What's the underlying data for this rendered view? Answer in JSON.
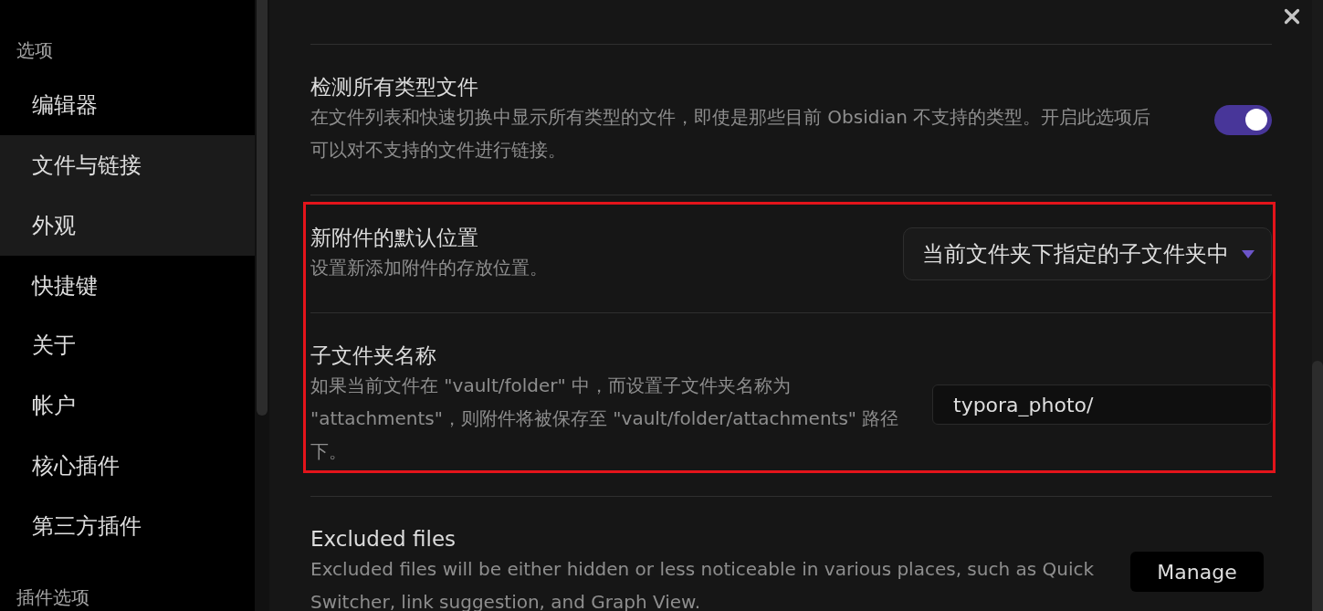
{
  "sidebar": {
    "header": "选项",
    "items": [
      {
        "label": "编辑器",
        "highlighted": false
      },
      {
        "label": "文件与链接",
        "highlighted": true
      },
      {
        "label": "外观",
        "highlighted": true
      },
      {
        "label": "快捷键",
        "highlighted": false
      },
      {
        "label": "关于",
        "highlighted": false
      },
      {
        "label": "帐户",
        "highlighted": false
      },
      {
        "label": "核心插件",
        "highlighted": false
      },
      {
        "label": "第三方插件",
        "highlighted": false
      }
    ],
    "footer_header": "插件选项"
  },
  "settings": [
    {
      "kind": "toggle",
      "title": "检测所有类型文件",
      "description": "在文件列表和快速切换中显示所有类型的文件，即使是那些目前 Obsidian 不支持的类型。开启此选项后可以对不支持的文件进行链接。",
      "on": true,
      "highlighted": false
    },
    {
      "kind": "dropdown",
      "title": "新附件的默认位置",
      "description": "设置新添加附件的存放位置。",
      "value": "当前文件夹下指定的子文件夹中",
      "highlighted": true
    },
    {
      "kind": "text",
      "title": "子文件夹名称",
      "description": "如果当前文件在 \"vault/folder\" 中，而设置子文件夹名称为 \"attachments\"，则附件将被保存至 \"vault/folder/attachments\" 路径下。",
      "value": "typora_photo/",
      "highlighted": true
    },
    {
      "kind": "button",
      "title": "Excluded files",
      "description": "Excluded files will be either hidden or less noticeable in various places, such as Quick Switcher, link suggestion, and Graph View.",
      "button": "Manage",
      "highlighted": false
    }
  ]
}
